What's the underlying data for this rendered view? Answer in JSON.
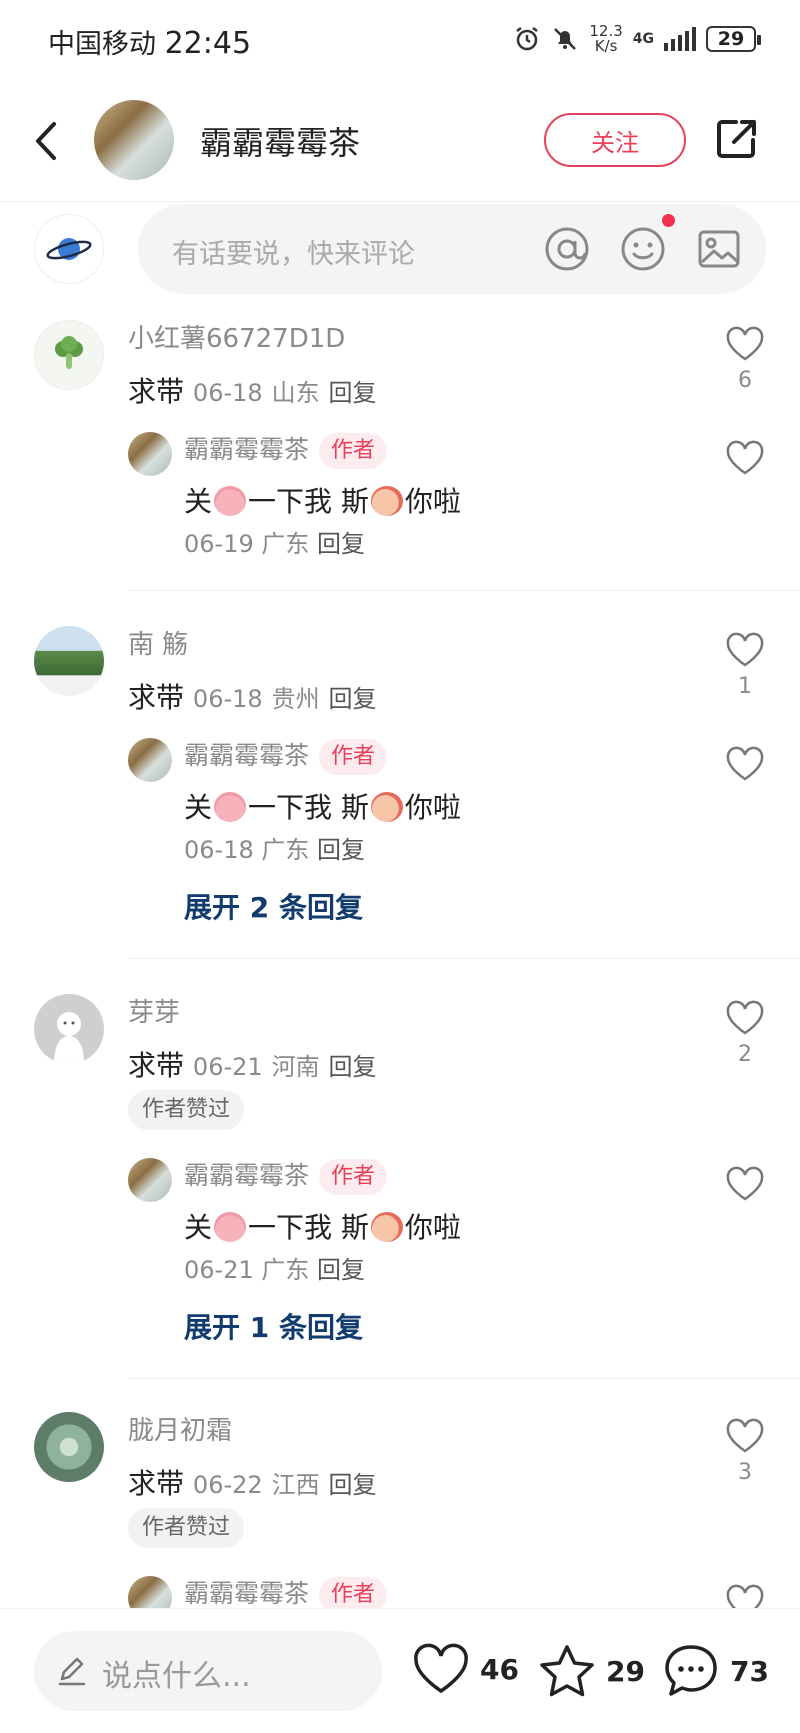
{
  "status_bar": {
    "carrier": "中国移动",
    "time": "22:45",
    "net_speed_value": "12.3",
    "net_speed_unit": "K/s",
    "network": "4G",
    "battery": "29"
  },
  "header": {
    "author_name": "霸霸霉霉茶",
    "follow_label": "关注"
  },
  "comment_input": {
    "placeholder": "有话要说，快来评论"
  },
  "comments": [
    {
      "name": "小红薯66727D1D",
      "text": "求带",
      "date": "06-18",
      "location": "山东",
      "reply_label": "回复",
      "likes": "6",
      "reply": {
        "name": "霸霸霉霉茶",
        "badge": "作者",
        "text_a": "关",
        "text_b": "一下我 斯",
        "text_c": "你啦",
        "date": "06-19",
        "location": "广东",
        "reply_label": "回复"
      }
    },
    {
      "name": "南 觞",
      "text": "求带",
      "date": "06-18",
      "location": "贵州",
      "reply_label": "回复",
      "likes": "1",
      "reply": {
        "name": "霸霸霉霉茶",
        "badge": "作者",
        "text_a": "关",
        "text_b": "一下我 斯",
        "text_c": "你啦",
        "date": "06-18",
        "location": "广东",
        "reply_label": "回复"
      },
      "expand_label": "展开 2 条回复"
    },
    {
      "name": "芽芽",
      "text": "求带",
      "date": "06-21",
      "location": "河南",
      "reply_label": "回复",
      "liked_badge": "作者赞过",
      "likes": "2",
      "reply": {
        "name": "霸霸霉霉茶",
        "badge": "作者",
        "text_a": "关",
        "text_b": "一下我 斯",
        "text_c": "你啦",
        "date": "06-21",
        "location": "广东",
        "reply_label": "回复"
      },
      "expand_label": "展开 1 条回复"
    },
    {
      "name": "胧月初霜",
      "text": "求带",
      "date": "06-22",
      "location": "江西",
      "reply_label": "回复",
      "liked_badge": "作者赞过",
      "likes": "3",
      "reply": {
        "name": "霸霸霉霉茶",
        "badge": "作者"
      }
    }
  ],
  "bottom_bar": {
    "placeholder": "说点什么...",
    "likes": "46",
    "favorites": "29",
    "comments": "73"
  },
  "colors": {
    "accent": "#e8405a",
    "expand_link": "#123c6e"
  }
}
